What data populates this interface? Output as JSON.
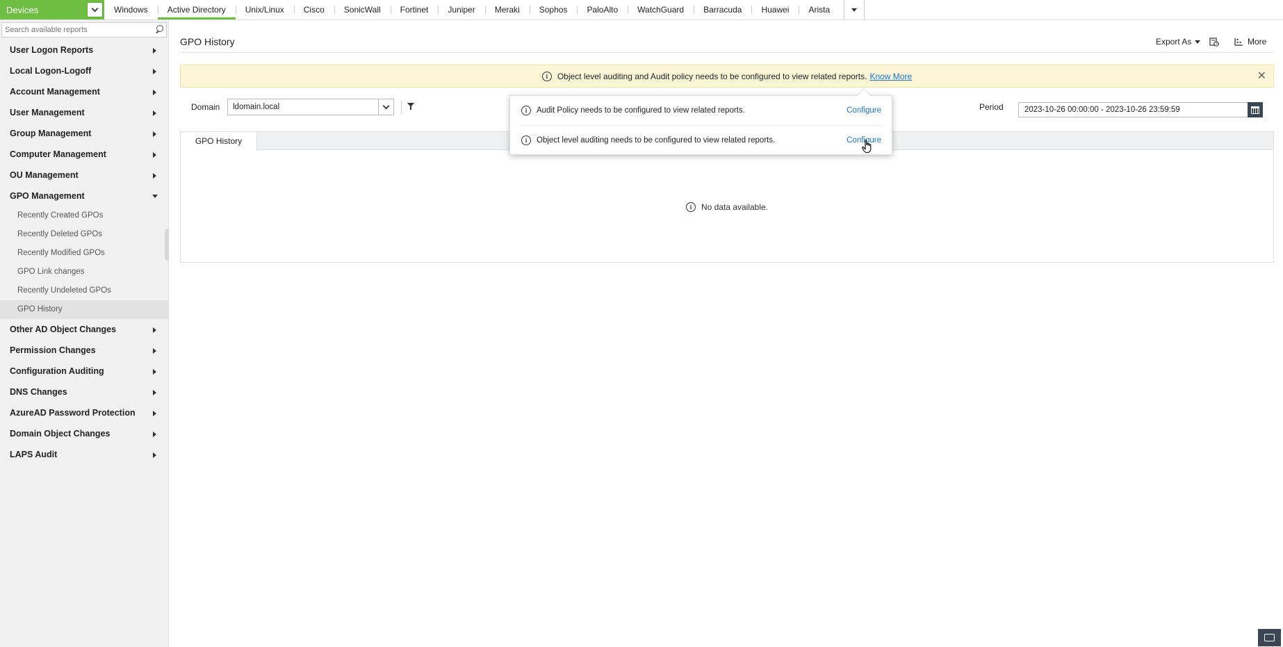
{
  "topbar": {
    "devices_label": "Devices",
    "tabs": [
      {
        "label": "Windows",
        "active": false
      },
      {
        "label": "Active Directory",
        "active": true
      },
      {
        "label": "Unix/Linux",
        "active": false
      },
      {
        "label": "Cisco",
        "active": false
      },
      {
        "label": "SonicWall",
        "active": false
      },
      {
        "label": "Fortinet",
        "active": false
      },
      {
        "label": "Juniper",
        "active": false
      },
      {
        "label": "Meraki",
        "active": false
      },
      {
        "label": "Sophos",
        "active": false
      },
      {
        "label": "PaloAlto",
        "active": false
      },
      {
        "label": "WatchGuard",
        "active": false
      },
      {
        "label": "Barracuda",
        "active": false
      },
      {
        "label": "Huawei",
        "active": false
      },
      {
        "label": "Arista",
        "active": false
      }
    ],
    "accent_color": "#6fbe44"
  },
  "sidebar": {
    "search_placeholder": "Search available reports",
    "items": [
      {
        "label": "User Logon Reports"
      },
      {
        "label": "Local Logon-Logoff"
      },
      {
        "label": "Account Management"
      },
      {
        "label": "User Management"
      },
      {
        "label": "Group Management"
      },
      {
        "label": "Computer Management"
      },
      {
        "label": "OU Management"
      },
      {
        "label": "GPO Management"
      },
      {
        "label": "Other AD Object Changes"
      },
      {
        "label": "Permission Changes"
      },
      {
        "label": "Configuration Auditing"
      },
      {
        "label": "DNS Changes"
      },
      {
        "label": "AzureAD Password Protection"
      },
      {
        "label": "Domain Object Changes"
      },
      {
        "label": "LAPS Audit"
      }
    ],
    "gpo_subitems": [
      {
        "label": "Recently Created GPOs"
      },
      {
        "label": "Recently Deleted GPOs"
      },
      {
        "label": "Recently Modified GPOs"
      },
      {
        "label": "GPO Link changes"
      },
      {
        "label": "Recently Undeleted GPOs"
      },
      {
        "label": "GPO History"
      }
    ]
  },
  "main": {
    "title": "GPO History",
    "export_label": "Export As",
    "more_label": "More",
    "banner": {
      "text": "Object level auditing and Audit policy needs to be configured to view related reports.",
      "link": "Know More",
      "close": "✕"
    },
    "domain_label": "Domain",
    "domain_value": "ldomain.local",
    "period_label": "Period",
    "period_value": "2023-10-26 00:00:00 - 2023-10-26 23:59:59",
    "report_tab": "GPO History",
    "no_data": "No data available."
  },
  "popover": {
    "rows": [
      {
        "text": "Audit Policy needs to be configured to view related reports.",
        "action": "Configure"
      },
      {
        "text": "Object level auditing needs to be configured to view related reports.",
        "action": "Configure"
      }
    ]
  },
  "icons": {
    "info": "i"
  }
}
